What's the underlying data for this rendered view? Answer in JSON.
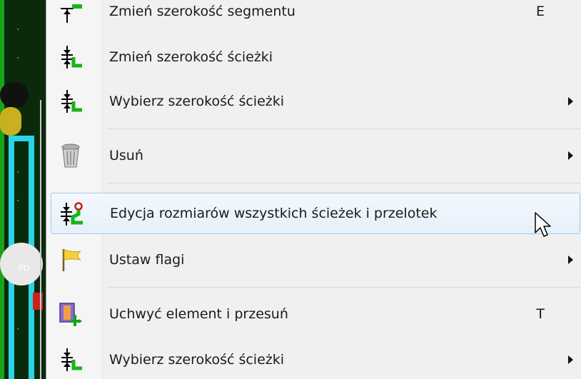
{
  "canvas": {
    "net_label": "PD"
  },
  "menu": {
    "items": [
      {
        "label": "Zmień szerokość segmentu",
        "shortcut": "E",
        "submenu": false,
        "icon": "track-width-icon"
      },
      {
        "label": "Zmień szerokość ścieżki",
        "shortcut": "",
        "submenu": false,
        "icon": "track-width-icon"
      },
      {
        "label": "Wybierz szerokość ścieżki",
        "shortcut": "",
        "submenu": true,
        "icon": "track-width-icon"
      },
      {
        "label": "Usuń",
        "shortcut": "",
        "submenu": true,
        "icon": "trash-icon"
      },
      {
        "label": "Edycja rozmiarów wszystkich ścieżek i przelotek",
        "shortcut": "",
        "submenu": false,
        "icon": "track-via-size-icon",
        "highlighted": true
      },
      {
        "label": "Ustaw flagi",
        "shortcut": "",
        "submenu": true,
        "icon": "flag-icon"
      },
      {
        "label": "Uchwyć element i przesuń",
        "shortcut": "T",
        "submenu": false,
        "icon": "move-item-icon"
      },
      {
        "label": "Wybierz szerokość ścieżki",
        "shortcut": "",
        "submenu": true,
        "icon": "track-width-icon"
      }
    ]
  },
  "colors": {
    "highlight_border": "#a8c8e8",
    "pcb_background": "#0b2a0b",
    "track_cyan": "#2ad4e6",
    "track_green": "#1aa31a"
  }
}
